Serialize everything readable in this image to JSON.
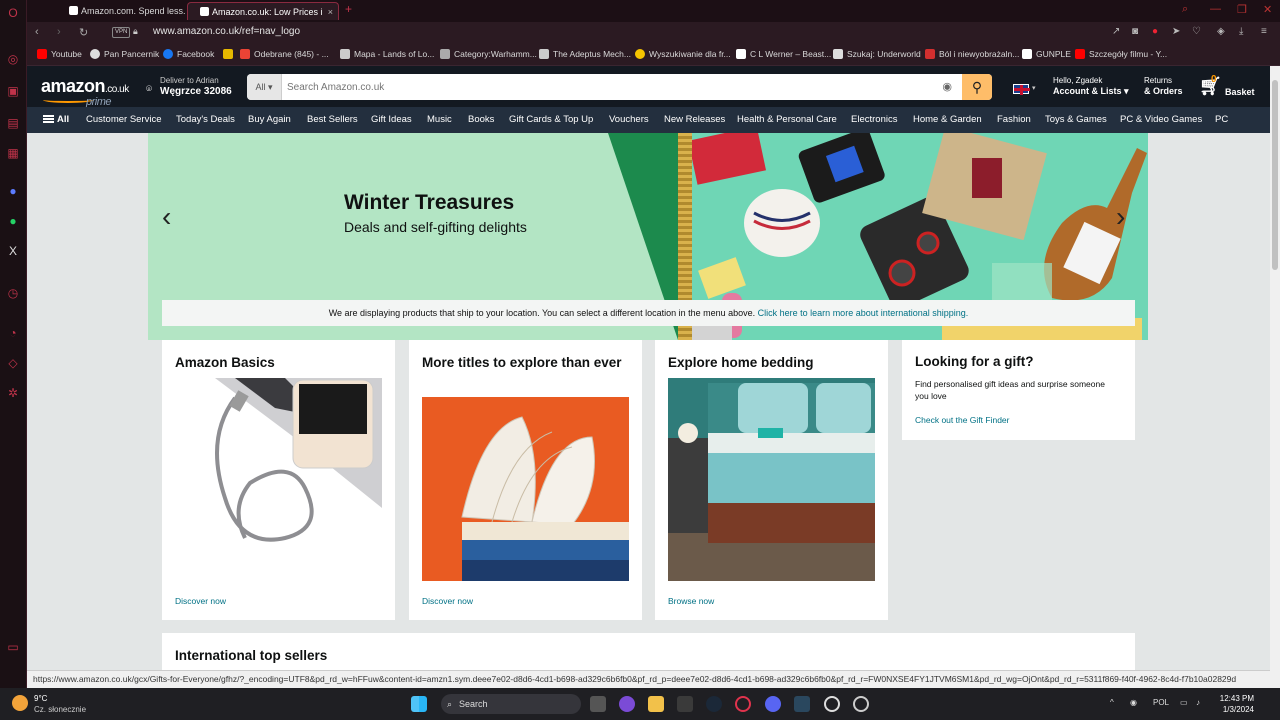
{
  "browser": {
    "tabs": [
      {
        "label": "Amazon.com. Spend less. S"
      },
      {
        "label": "Amazon.co.uk: Low Prices i"
      }
    ],
    "vpn_label": "VPN",
    "url": "www.amazon.co.uk/ref=nav_logo",
    "bookmarks": [
      {
        "label": "Youtube",
        "color": "#ff0000"
      },
      {
        "label": "Pan Pancernik",
        "color": "#dddddd"
      },
      {
        "label": "Facebook",
        "color": "#1877f2"
      },
      {
        "label": "",
        "color": "#e6b800"
      },
      {
        "label": "Odebrane (845) - ...",
        "color": "#ea4335"
      },
      {
        "label": "Mapa - Lands of Lo...",
        "color": "#cccccc"
      },
      {
        "label": "Category:Warhamm...",
        "color": "#aaaaaa"
      },
      {
        "label": "The Adeptus Mech...",
        "color": "#cccccc"
      },
      {
        "label": "Wyszukiwanie dla fr...",
        "color": "#f5c400"
      },
      {
        "label": "C L Werner – Beast...",
        "color": "#ffffff"
      },
      {
        "label": "Szukaj: Underworld",
        "color": "#dddddd"
      },
      {
        "label": "Ból i niewyobrażaln...",
        "color": "#d32f2f"
      },
      {
        "label": "GUNPLE",
        "color": "#ffffff"
      },
      {
        "label": "Szczegóły filmu - Y...",
        "color": "#ff0000"
      }
    ],
    "status_url": "https://www.amazon.co.uk/gcx/Gifts-for-Everyone/gfhz/?_encoding=UTF8&pd_rd_w=hFFuw&content-id=amzn1.sym.deee7e02-d8d6-4cd1-b698-ad329c6b6fb0&pf_rd_p=deee7e02-d8d6-4cd1-b698-ad329c6b6fb0&pf_rd_r=FW0NXSE4FY1JTVM6SM1&pd_rd_wg=OjOnt&pd_rd_r=5311f869-f40f-4962-8c4d-f7b10a02829d"
  },
  "amazon": {
    "logo_text": "amazon",
    "logo_domain": ".co.uk",
    "logo_prime": "prime",
    "deliver_line1": "Deliver to Adrian",
    "deliver_line2": "Węgrzce 32086",
    "search_category": "All",
    "search_placeholder": "Search Amazon.co.uk",
    "account_line1": "Hello, Zgadek",
    "account_line2": "Account & Lists",
    "returns_line1": "Returns",
    "returns_line2": "& Orders",
    "basket_count": "0",
    "basket_label": "Basket",
    "subnav": [
      "All",
      "Customer Service",
      "Today's Deals",
      "Buy Again",
      "Best Sellers",
      "Gift Ideas",
      "Music",
      "Books",
      "Gift Cards & Top Up",
      "Vouchers",
      "New Releases",
      "Health & Personal Care",
      "Electronics",
      "Home & Garden",
      "Fashion",
      "Toys & Games",
      "PC & Video Games",
      "PC"
    ]
  },
  "hero": {
    "title": "Winter Treasures",
    "subtitle": "Deals and self-gifting delights"
  },
  "notice": {
    "text": "We are displaying products that ship to your location. You can select a different location in the menu above.",
    "link": "Click here to learn more about international shipping."
  },
  "cards": [
    {
      "title": "Amazon Basics",
      "link": "Discover now"
    },
    {
      "title": "More titles to explore than ever",
      "link": "Discover now"
    },
    {
      "title": "Explore home bedding",
      "link": "Browse now"
    }
  ],
  "gift_card": {
    "title": "Looking for a gift?",
    "text": "Find personalised gift ideas and surprise someone you love",
    "link": "Check out the Gift Finder"
  },
  "bottom_card": {
    "title": "International top sellers"
  },
  "taskbar": {
    "temp": "9°C",
    "weather": "Cz. słonecznie",
    "search": "Search",
    "lang": "POL",
    "time": "12:43 PM",
    "date": "1/3/2024"
  }
}
